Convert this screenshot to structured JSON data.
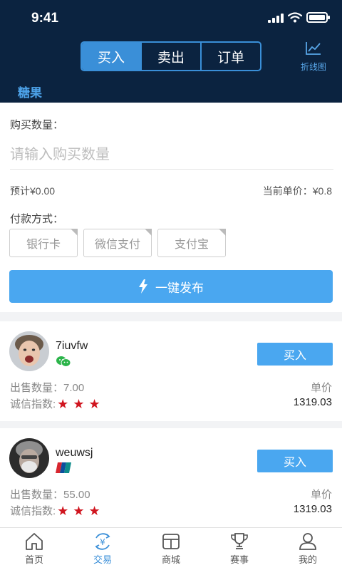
{
  "status": {
    "time": "9:41"
  },
  "header": {
    "segments": [
      {
        "label": "买入",
        "active": true
      },
      {
        "label": "卖出",
        "active": false
      },
      {
        "label": "订单",
        "active": false
      }
    ],
    "chart_label": "折线图",
    "category_tab": "糖果"
  },
  "form": {
    "quantity_label": "购买数量：",
    "quantity_placeholder": "请输入购买数量",
    "estimate": "预计¥0.00",
    "unit_price": "当前单价：¥0.8",
    "payment_label": "付款方式：",
    "payment_methods": [
      "银行卡",
      "微信支付",
      "支付宝"
    ],
    "publish_label": "一键发布"
  },
  "listings": [
    {
      "username": "7iuvfw",
      "payment_icon": "wechat-icon",
      "sell_qty": "出售数量：7.00",
      "credit_label": "诚信指数:",
      "stars": 3,
      "price_label": "单价",
      "price": "1319.03",
      "buy_label": "买入"
    },
    {
      "username": "weuwsj",
      "payment_icon": "unionpay-icon",
      "sell_qty": "出售数量：55.00",
      "credit_label": "诚信指数:",
      "stars": 3,
      "price_label": "单价",
      "price": "1319.03",
      "buy_label": "买入"
    }
  ],
  "tabbar": [
    {
      "label": "首页",
      "icon": "home-icon",
      "active": false
    },
    {
      "label": "交易",
      "icon": "trade-icon",
      "active": true
    },
    {
      "label": "商城",
      "icon": "shop-icon",
      "active": false
    },
    {
      "label": "赛事",
      "icon": "trophy-icon",
      "active": false
    },
    {
      "label": "我的",
      "icon": "user-icon",
      "active": false
    }
  ],
  "colors": {
    "header_bg": "#0b2340",
    "accent": "#4aa7f0",
    "star": "#d0151f"
  }
}
